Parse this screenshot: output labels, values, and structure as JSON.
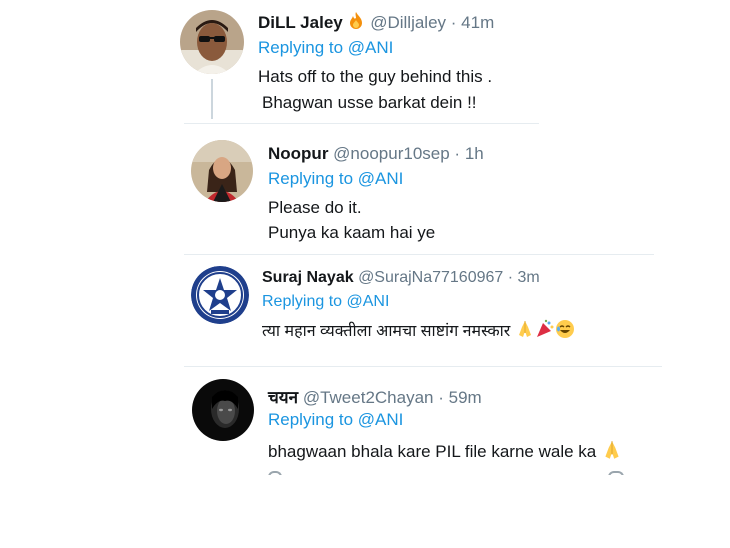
{
  "replies": [
    {
      "name": "DiLL Jaley",
      "name_emoji": "fire-emoji",
      "handle": "@Dilljaley",
      "sep": "·",
      "time": "41m",
      "replying_prefix": "Replying to",
      "replying_to": "@ANI",
      "text_lines": [
        "Hats off to the guy behind this .",
        "Bhagwan usse barkat dein !!"
      ]
    },
    {
      "name": "Noopur",
      "handle": "@noopur10sep",
      "sep": "·",
      "time": "1h",
      "replying_prefix": "Replying to",
      "replying_to": "@ANI",
      "text_lines": [
        "Please do it.",
        "Punya ka kaam hai ye"
      ]
    },
    {
      "name": "Suraj Nayak",
      "handle": "@SurajNa77160967",
      "sep": "·",
      "time": "3m",
      "replying_prefix": "Replying to",
      "replying_to": "@ANI",
      "text_lines": [
        "त्या महान व्यक्तीला आमचा साष्टांग नमस्कार"
      ],
      "text_emojis": [
        "folded-hands-emoji",
        "party-popper-emoji",
        "crying-laughing-emoji"
      ]
    },
    {
      "name": "चयन",
      "handle": "@Tweet2Chayan",
      "sep": "·",
      "time": "59m",
      "replying_prefix": "Replying to",
      "replying_to": "@ANI",
      "text_lines": [
        "bhagwaan bhala kare PIL file karne wale ka"
      ],
      "text_emojis": [
        "folded-hands-emoji"
      ]
    }
  ],
  "colors": {
    "link": "#1b95e0",
    "muted": "#657786",
    "text": "#14171a",
    "divider": "#e6ecf0"
  }
}
